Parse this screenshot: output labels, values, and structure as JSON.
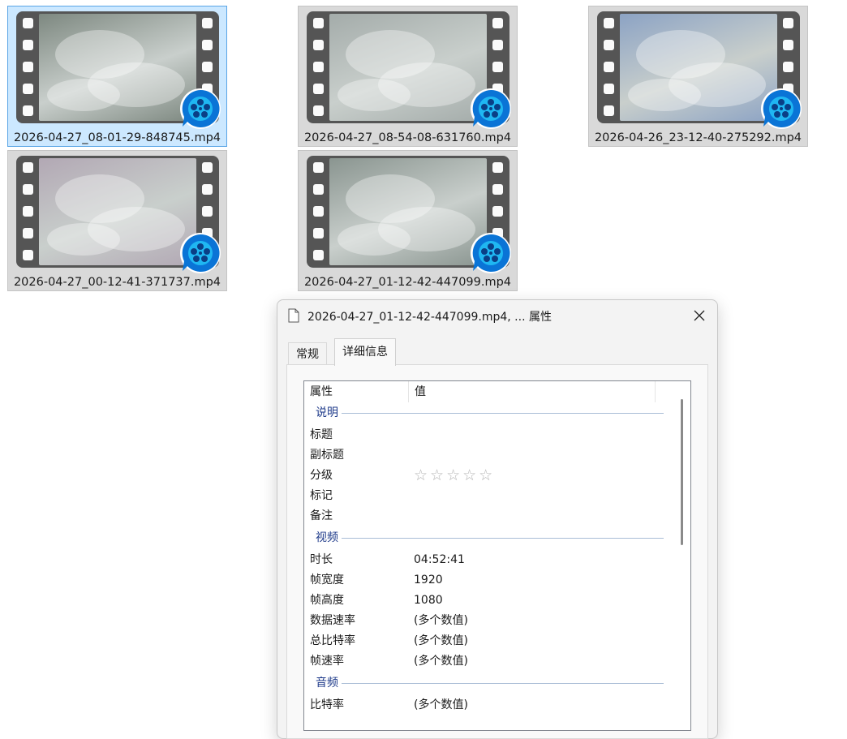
{
  "files": [
    {
      "name": "2026-04-27_08-01-29-848745.mp4",
      "selected": true,
      "tint": "#7d8880"
    },
    {
      "name": "2026-04-27_08-54-08-631760.mp4",
      "selected": false,
      "tint": "#a4acaa"
    },
    {
      "name": "2026-04-26_23-12-40-275292.mp4",
      "selected": false,
      "tint": "#8ca3c4"
    },
    {
      "name": "2026-04-27_00-12-41-371737.mp4",
      "selected": false,
      "tint": "#b2a8b4"
    },
    {
      "name": "2026-04-27_01-12-42-447099.mp4",
      "selected": false,
      "tint": "#8a9590"
    }
  ],
  "dialog": {
    "title": "2026-04-27_01-12-42-447099.mp4, ... 属性",
    "tabs": {
      "general": "常规",
      "details": "详细信息"
    },
    "headers": {
      "property": "属性",
      "value": "值"
    },
    "groups": {
      "description": "说明",
      "video": "视频",
      "audio": "音频"
    },
    "description_rows": [
      {
        "k": "标题",
        "v": ""
      },
      {
        "k": "副标题",
        "v": ""
      },
      {
        "k": "分级",
        "v": "☆☆☆☆☆"
      },
      {
        "k": "标记",
        "v": ""
      },
      {
        "k": "备注",
        "v": ""
      }
    ],
    "video_rows": [
      {
        "k": "时长",
        "v": "04:52:41"
      },
      {
        "k": "帧宽度",
        "v": "1920"
      },
      {
        "k": "帧高度",
        "v": "1080"
      },
      {
        "k": "数据速率",
        "v": "(多个数值)"
      },
      {
        "k": "总比特率",
        "v": "(多个数值)"
      },
      {
        "k": "帧速率",
        "v": "(多个数值)"
      }
    ],
    "audio_rows": [
      {
        "k": "比特率",
        "v": "(多个数值)"
      }
    ]
  },
  "colors": {
    "accent": "#1e6fd9",
    "selection": "#cce8ff",
    "badge": "#0a74d6"
  }
}
